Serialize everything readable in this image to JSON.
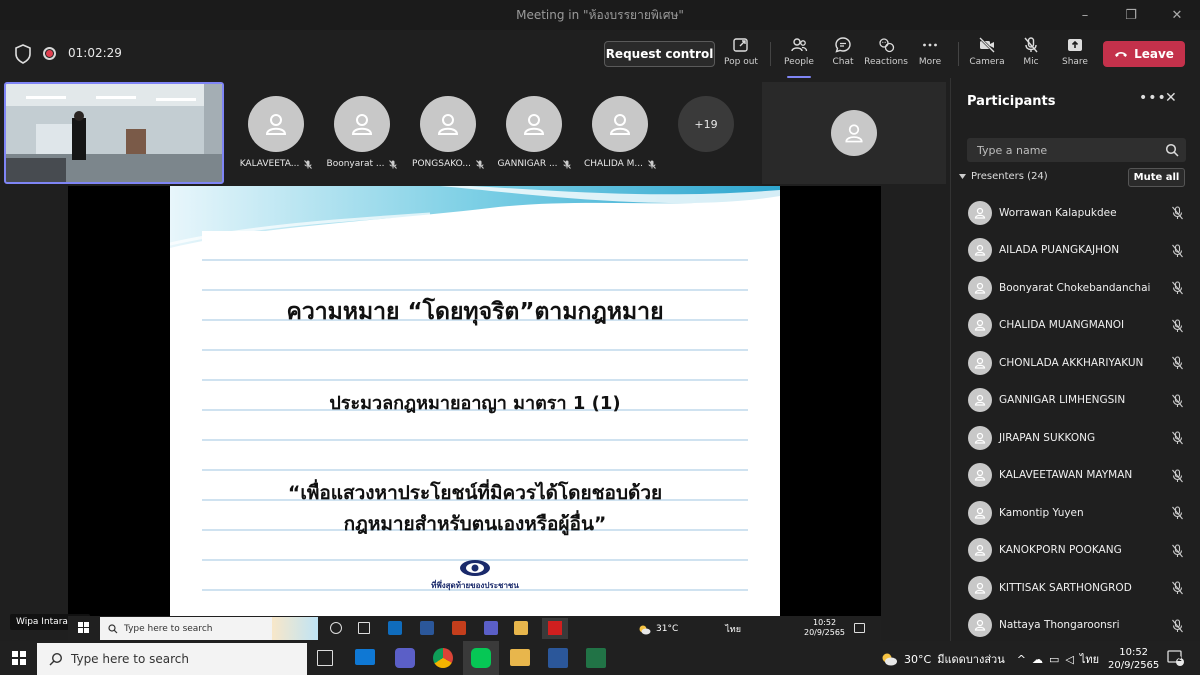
{
  "window": {
    "title": "Meeting in \"ห้องบรรยายพิเศษ\"",
    "controls": [
      "–",
      "❐",
      "✕"
    ]
  },
  "toolbar": {
    "timer": "01:02:29",
    "request_control": "Request control",
    "buttons": {
      "popout": "Pop out",
      "people": "People",
      "chat": "Chat",
      "reactions": "Reactions",
      "more": "More",
      "camera": "Camera",
      "mic": "Mic",
      "share": "Share"
    },
    "leave": "Leave"
  },
  "stage": {
    "tiles": [
      {
        "name": "KALAVEETA..."
      },
      {
        "name": "Boonyarat ..."
      },
      {
        "name": "PONGSAKO..."
      },
      {
        "name": "GANNIGAR ..."
      },
      {
        "name": "CHALIDA M..."
      }
    ],
    "overflow": "+19",
    "presenter_label": "Wipa Intarasuk"
  },
  "slide": {
    "title": "ความหมาย “โดยทุจริต”ตามกฎหมาย",
    "subtitle": "ประมวลกฎหมายอาญา มาตรา 1 (1)",
    "quote_line1": "“เพื่อแสวงหาประโยชน์ที่มิควรได้โดยชอบด้วย",
    "quote_line2": "กฎหมายสำหรับตนเองหรือผู้อื่น”",
    "logo_text": "ที่พึ่งสุดท้ายของประชาชน"
  },
  "inner_taskbar": {
    "search_placeholder": "Type here to search",
    "weather": "31°C",
    "lang": "ไทย",
    "time": "10:52",
    "date": "20/9/2565"
  },
  "panel": {
    "title": "Participants",
    "search_placeholder": "Type a name",
    "presenters_label": "Presenters (24)",
    "mute_all": "Mute all",
    "participants": [
      "Worrawan Kalapukdee",
      "AILADA PUANGKAJHON",
      "Boonyarat Chokebandanchai",
      "CHALIDA MUANGMANOI",
      "CHONLADA AKKHARIYAKUN",
      "GANNIGAR LIMHENGSIN",
      "JIRAPAN SUKKONG",
      "KALAVEETAWAN MAYMAN",
      "Kamontip Yuyen",
      "KANOKPORN POOKANG",
      "KITTISAK SARTHONGROD",
      "Nattaya Thongaroonsri"
    ]
  },
  "taskbar": {
    "search_placeholder": "Type here to search",
    "weather": "30°C",
    "weather_desc": "มีแดดบางส่วน",
    "lang": "ไทย",
    "time": "10:52",
    "date": "20/9/2565",
    "notif_count": "2"
  },
  "colors": {
    "accent": "#7f85f5",
    "leave": "#c4314b",
    "bg": "#1f1f1f"
  }
}
